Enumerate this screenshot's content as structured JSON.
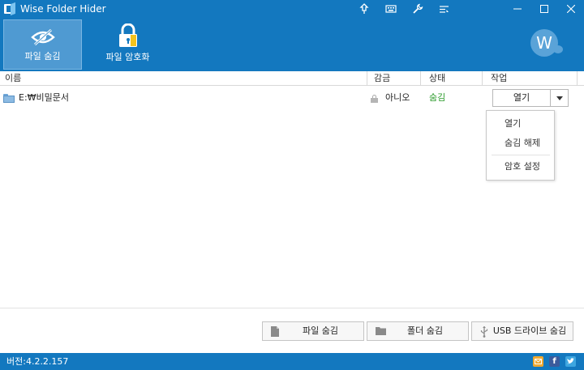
{
  "window": {
    "title": "Wise Folder Hider"
  },
  "titlebar_icons": [
    "pin-icon",
    "keyboard-icon",
    "wrench-icon",
    "menu-list-icon"
  ],
  "toolbar": {
    "items": [
      {
        "label": "파일 숨김",
        "icon": "hidden-eye-icon",
        "active": true
      },
      {
        "label": "파일 암호화",
        "icon": "lock-icon",
        "active": false
      }
    ],
    "avatar_letter": "W"
  },
  "table": {
    "columns": [
      "이름",
      "감금",
      "상태",
      "작업"
    ],
    "rows": [
      {
        "name": "E:₩비밀문서",
        "locked": "아니오",
        "status": "숨김",
        "action": "열기"
      }
    ]
  },
  "dropdown": {
    "items": [
      "열기",
      "숨김 해제",
      "암호 설정"
    ]
  },
  "bottom_buttons": [
    "파일 숨김",
    "폴더 숨김",
    "USB 드라이브 숨김"
  ],
  "statusbar": {
    "version": "버전:4.2.2.157"
  },
  "colors": {
    "primary": "#1378bf",
    "active_tool": "#4f9ad2",
    "status_hidden": "#2a9a2a"
  }
}
